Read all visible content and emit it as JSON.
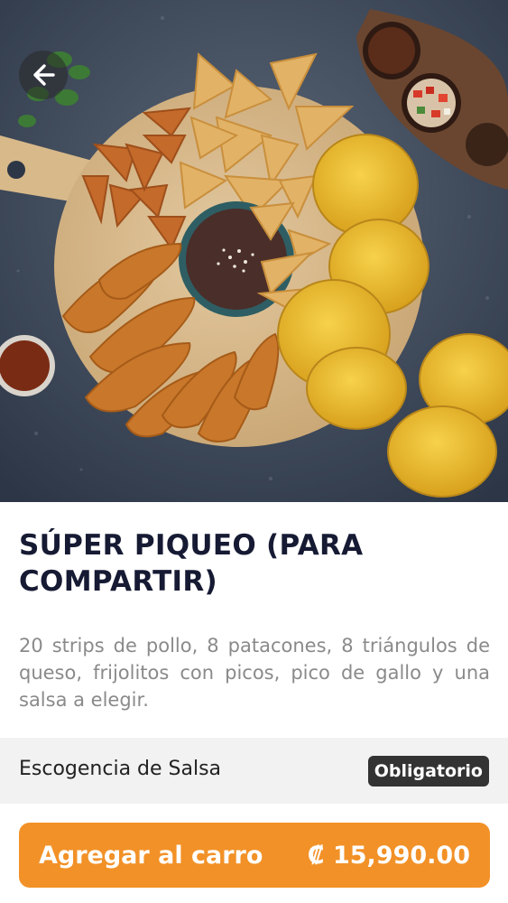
{
  "product": {
    "title": "SÚPER PIQUEO (PARA COMPARTIR)",
    "description": "20 strips de pollo, 8 patacones, 8 triángulos de queso, frijolitos con picos, pico de gallo y una salsa a elegir."
  },
  "options": {
    "section_label": "Escogencia de Salsa",
    "required_badge": "Obligatorio"
  },
  "cart": {
    "button_label": "Agregar al carro",
    "price": "₡ 15,990.00"
  },
  "icons": {
    "back": "arrow-left-icon"
  },
  "colors": {
    "accent": "#f29127",
    "title": "#161a33",
    "badge": "#333333",
    "section_bg": "#f2f2f2"
  }
}
